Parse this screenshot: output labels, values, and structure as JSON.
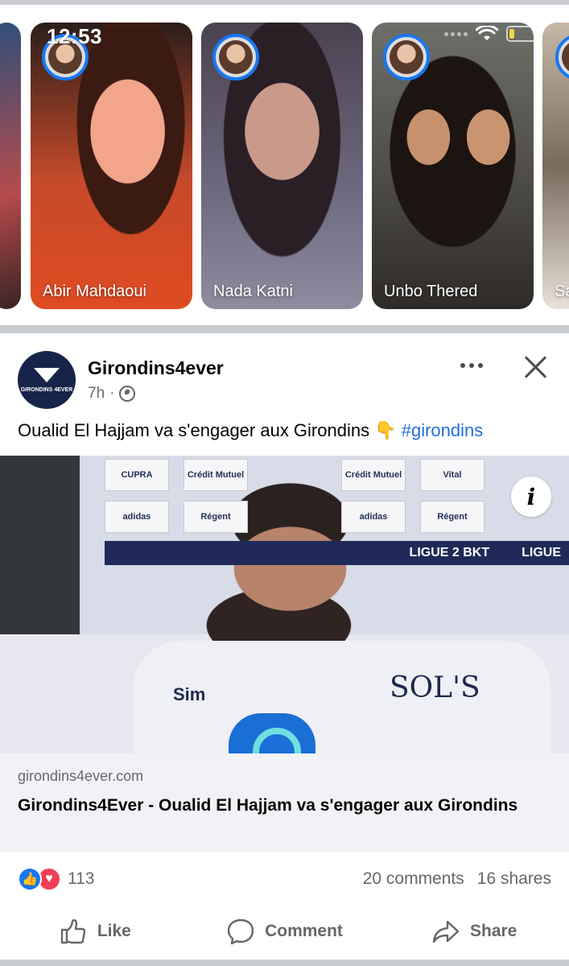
{
  "status_bar": {
    "time": "12:53",
    "battery_level": 0.18,
    "battery_color": "#f4d83a"
  },
  "stories": [
    {
      "name": ""
    },
    {
      "name": "Abir Mahdaoui"
    },
    {
      "name": "Nada Katni"
    },
    {
      "name": "Unbo Thered"
    },
    {
      "name": "Sa"
    }
  ],
  "post": {
    "author": "Girondins4ever",
    "avatar_text": "GIRONDINS 4EVER",
    "time": "7h",
    "separator": "·",
    "text": "Oualid El Hajjam va s'engager aux Girondins",
    "emoji": "👇",
    "hashtag": "#girondins",
    "link": {
      "domain": "girondins4ever.com",
      "title": "Girondins4Ever - Oualid El Hajjam va s'engager aux Girondins"
    },
    "image_text": {
      "sponsors_row1": [
        "CUPRA",
        "Crédit Mutuel",
        "",
        "Crédit Mutuel",
        "Vital"
      ],
      "sponsors_row2": [
        "adidas",
        "Régent",
        "",
        "adidas",
        "Régent"
      ],
      "ligue_band": [
        "LIGUE 2 BKT",
        "LIGUE"
      ],
      "jersey_left": "Sim",
      "jersey_right": "SOL'S",
      "info_button": "i"
    },
    "reactions_count": "113",
    "comments": "20 comments",
    "shares": "16 shares"
  },
  "actions": {
    "like": "Like",
    "comment": "Comment",
    "share": "Share"
  },
  "colors": {
    "accent": "#1877f2",
    "hashtag": "#216fdb",
    "secondary_text": "#65676b",
    "love": "#f33e58"
  }
}
